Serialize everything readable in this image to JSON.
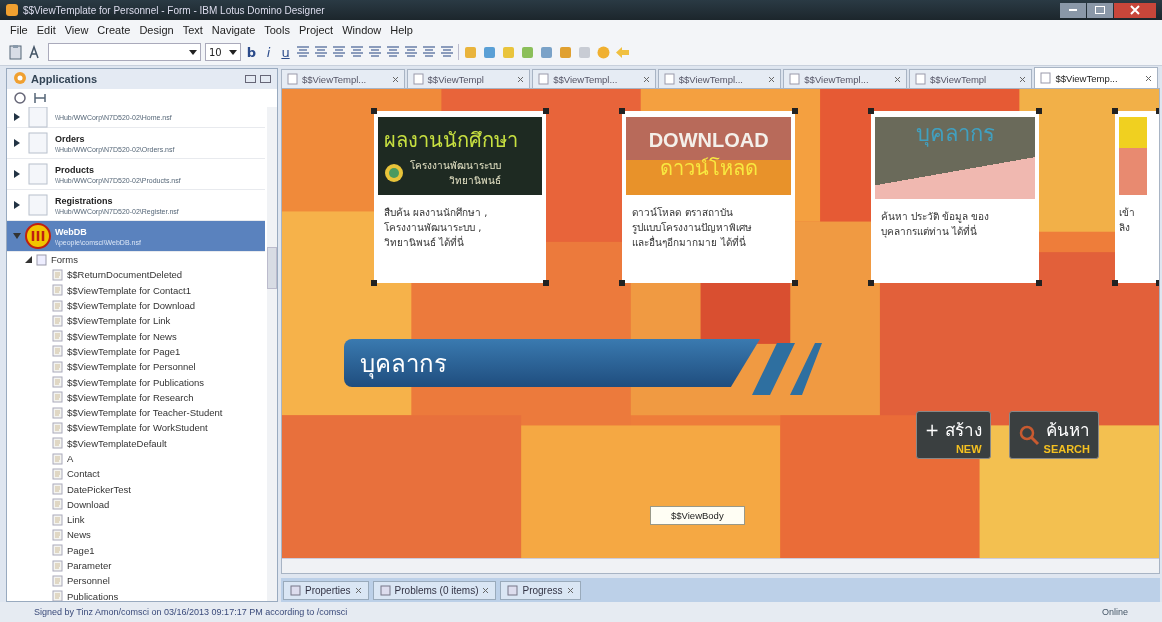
{
  "window": {
    "title": "$$ViewTemplate for Personnel - Form - IBM Lotus Domino Designer"
  },
  "menu": [
    "File",
    "Edit",
    "View",
    "Create",
    "Design",
    "Text",
    "Navigate",
    "Tools",
    "Project",
    "Window",
    "Help"
  ],
  "toolbar": {
    "font_size": "10",
    "format_buttons": [
      "b",
      "i",
      "u"
    ]
  },
  "applications_panel": {
    "title": "Applications",
    "apps": [
      {
        "path": "\\\\Hub/WWCorp\\N7D520-02\\Home.nsf",
        "selected": false,
        "expanded": false
      },
      {
        "name": "Orders",
        "path": "\\\\Hub/WWCorp\\N7D520-02\\Orders.nsf",
        "selected": false,
        "expanded": false
      },
      {
        "name": "Products",
        "path": "\\\\Hub/WWCorp\\N7D520-02\\Products.nsf",
        "selected": false,
        "expanded": false
      },
      {
        "name": "Registrations",
        "path": "\\\\Hub/WWCorp\\N7D520-02\\Register.nsf",
        "selected": false,
        "expanded": false
      },
      {
        "name": "WebDB",
        "path": "\\\\people\\comsci\\WebDB.nsf",
        "selected": true,
        "expanded": true
      }
    ],
    "tree": {
      "label": "Forms",
      "expanded": true,
      "children": [
        {
          "label": "$$ReturnDocumentDeleted"
        },
        {
          "label": "$$ViewTemplate for Contact1"
        },
        {
          "label": "$$ViewTemplate for Download"
        },
        {
          "label": "$$ViewTemplate for Link"
        },
        {
          "label": "$$ViewTemplate for News"
        },
        {
          "label": "$$ViewTemplate for Page1"
        },
        {
          "label": "$$ViewTemplate for Personnel"
        },
        {
          "label": "$$ViewTemplate for Publications"
        },
        {
          "label": "$$ViewTemplate for Research"
        },
        {
          "label": "$$ViewTemplate for Teacher-Student"
        },
        {
          "label": "$$ViewTemplate for WorkStudent"
        },
        {
          "label": "$$ViewTemplateDefault"
        },
        {
          "label": "A"
        },
        {
          "label": "Contact"
        },
        {
          "label": "DatePickerTest"
        },
        {
          "label": "Download"
        },
        {
          "label": "Link"
        },
        {
          "label": "News"
        },
        {
          "label": "Page1"
        },
        {
          "label": "Parameter"
        },
        {
          "label": "Personnel"
        },
        {
          "label": "Publications"
        }
      ]
    }
  },
  "editor_tabs": [
    {
      "label": "$$ViewTempl...",
      "selected": false
    },
    {
      "label": "$$ViewTempl",
      "selected": false
    },
    {
      "label": "$$ViewTempl...",
      "selected": false
    },
    {
      "label": "$$ViewTempl...",
      "selected": false
    },
    {
      "label": "$$ViewTempl...",
      "selected": false
    },
    {
      "label": "$$ViewTempl",
      "selected": false
    },
    {
      "label": "$$ViewTemp...",
      "selected": true
    }
  ],
  "canvas": {
    "cards": [
      {
        "kind": "dark",
        "banner_lines": [
          "ผลงานนักศึกษา",
          "โครงงานพัฒนาระบบ",
          "วิทยานิพนธ์"
        ],
        "description": "สืบค้น ผลงานนักศึกษา ,\nโครงงานพัฒนาระบบ ,\nวิทยานิพนธ์ ได้ที่นี่"
      },
      {
        "kind": "download",
        "banner_lines": [
          "DOWNLOAD",
          "ดาวน์โหลด"
        ],
        "description": "ดาวน์โหลด ตราสถาบัน\nรูปแบบโครงงานปัญหาพิเศษ\nและอื่นๆอีกมากมาย ได้ที่นี่"
      },
      {
        "kind": "people",
        "banner_lines": [
          "บุคลากร"
        ],
        "description": "ค้นหา ประวัติ ข้อมูล ของ\nบุคลากรแต่ท่าน ได้ที่นี่"
      },
      {
        "kind": "partial",
        "description": "เข้า\nลิง"
      }
    ],
    "section_banner": "บุคลากร",
    "buttons": [
      {
        "kind": "new",
        "label": "+ สร้าง",
        "sub": "NEW"
      },
      {
        "kind": "search",
        "label": "ค้นหา",
        "sub": "SEARCH"
      }
    ],
    "view_body_label": "$$ViewBody"
  },
  "bottom_tabs": [
    "Properties",
    "Problems (0 items)",
    "Progress"
  ],
  "status_bar": {
    "signed": "Signed by Tinz Amon/comsci on 03/16/2013 09:17:17 PM according to /comsci",
    "status": "Online"
  }
}
